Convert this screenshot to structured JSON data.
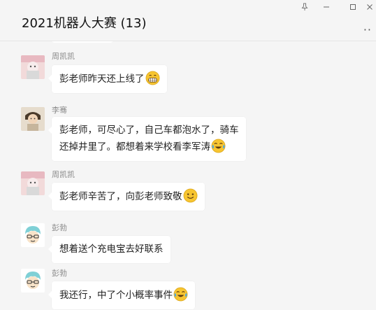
{
  "window": {
    "title": "2021机器人大赛 (13)",
    "controls": {
      "pin_glyph": "⊥",
      "minimize_glyph": "—",
      "maximize_glyph": "□",
      "close_glyph": "✕"
    },
    "more_glyph": "··"
  },
  "messages": [
    {
      "sender": "周凯凯",
      "avatar": "photo-avatar",
      "lines": [
        "彭老师昨天还上线了"
      ],
      "emoji": "grin-emoji"
    },
    {
      "sender": "李骞",
      "avatar": "portrait-avatar",
      "lines": [
        "彭老师，可尽心了，自己车都泡水了，骑车",
        "还掉井里了。都想着来学校看李军涛"
      ],
      "emoji": "laugh-cry-emoji"
    },
    {
      "sender": "周凯凯",
      "avatar": "photo-avatar",
      "lines": [
        "彭老师辛苦了，向彭老师致敬"
      ],
      "emoji": "smile-emoji"
    },
    {
      "sender": "彭勃",
      "avatar": "cartoon-avatar",
      "lines": [
        "想着送个充电宝去好联系"
      ]
    },
    {
      "sender": "彭勃",
      "avatar": "cartoon-avatar",
      "lines": [
        "我还行，中了个小概率事件"
      ],
      "emoji": "laugh-cry-emoji"
    }
  ],
  "colors": {
    "background": "#f5f5f5",
    "bubble": "#ffffff",
    "sender_name": "#8a8a8a",
    "emoji_yellow": "#f7c531"
  }
}
